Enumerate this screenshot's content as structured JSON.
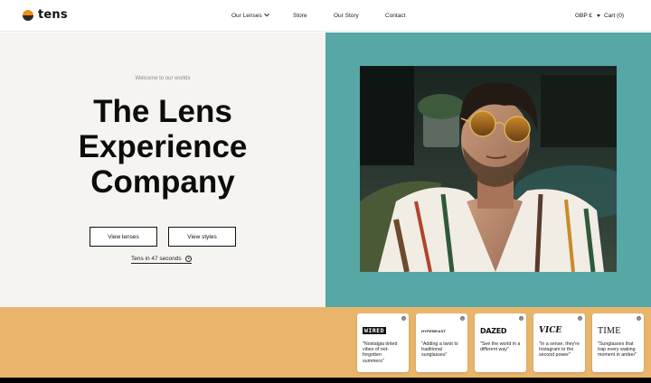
{
  "header": {
    "logo_text": "tens",
    "nav": [
      {
        "label": "Our Lenses"
      },
      {
        "label": "Store"
      },
      {
        "label": "Our Story"
      },
      {
        "label": "Contact"
      }
    ],
    "currency": "GBP £",
    "cart": "Cart (0)"
  },
  "hero": {
    "welcome": "Welcome to our worlds",
    "headline_lines": [
      "The Lens",
      "Experience",
      "Company"
    ],
    "button_lenses": "View lenses",
    "button_styles": "View styles",
    "tens_link": "Tens in 47 seconds"
  },
  "press": [
    {
      "brand": "WIRED",
      "brand_icon": "wired-logo",
      "quote": "\"Nostalgia tinted vibes of not-forgotten summers\""
    },
    {
      "brand": "HYPEBEAST",
      "brand_icon": "hypebeast-logo",
      "quote": "\"Adding a twist to traditional sunglasses\""
    },
    {
      "brand": "DAZED",
      "brand_icon": "dazed-logo",
      "quote": "\"See the world in a different way\""
    },
    {
      "brand": "VICE",
      "brand_icon": "vice-logo",
      "quote": "\"In a sense, they're Instagram to the second power\""
    },
    {
      "brand": "TIME",
      "brand_icon": "time-logo",
      "quote": "\"Sunglasses that trap every waking moment in amber\""
    }
  ],
  "colors": {
    "hero_right_bg": "#56a7a6",
    "press_bg": "#e9b56b",
    "hero_left_bg": "#f5f4f0",
    "logo_accent": "#f08a1c"
  }
}
